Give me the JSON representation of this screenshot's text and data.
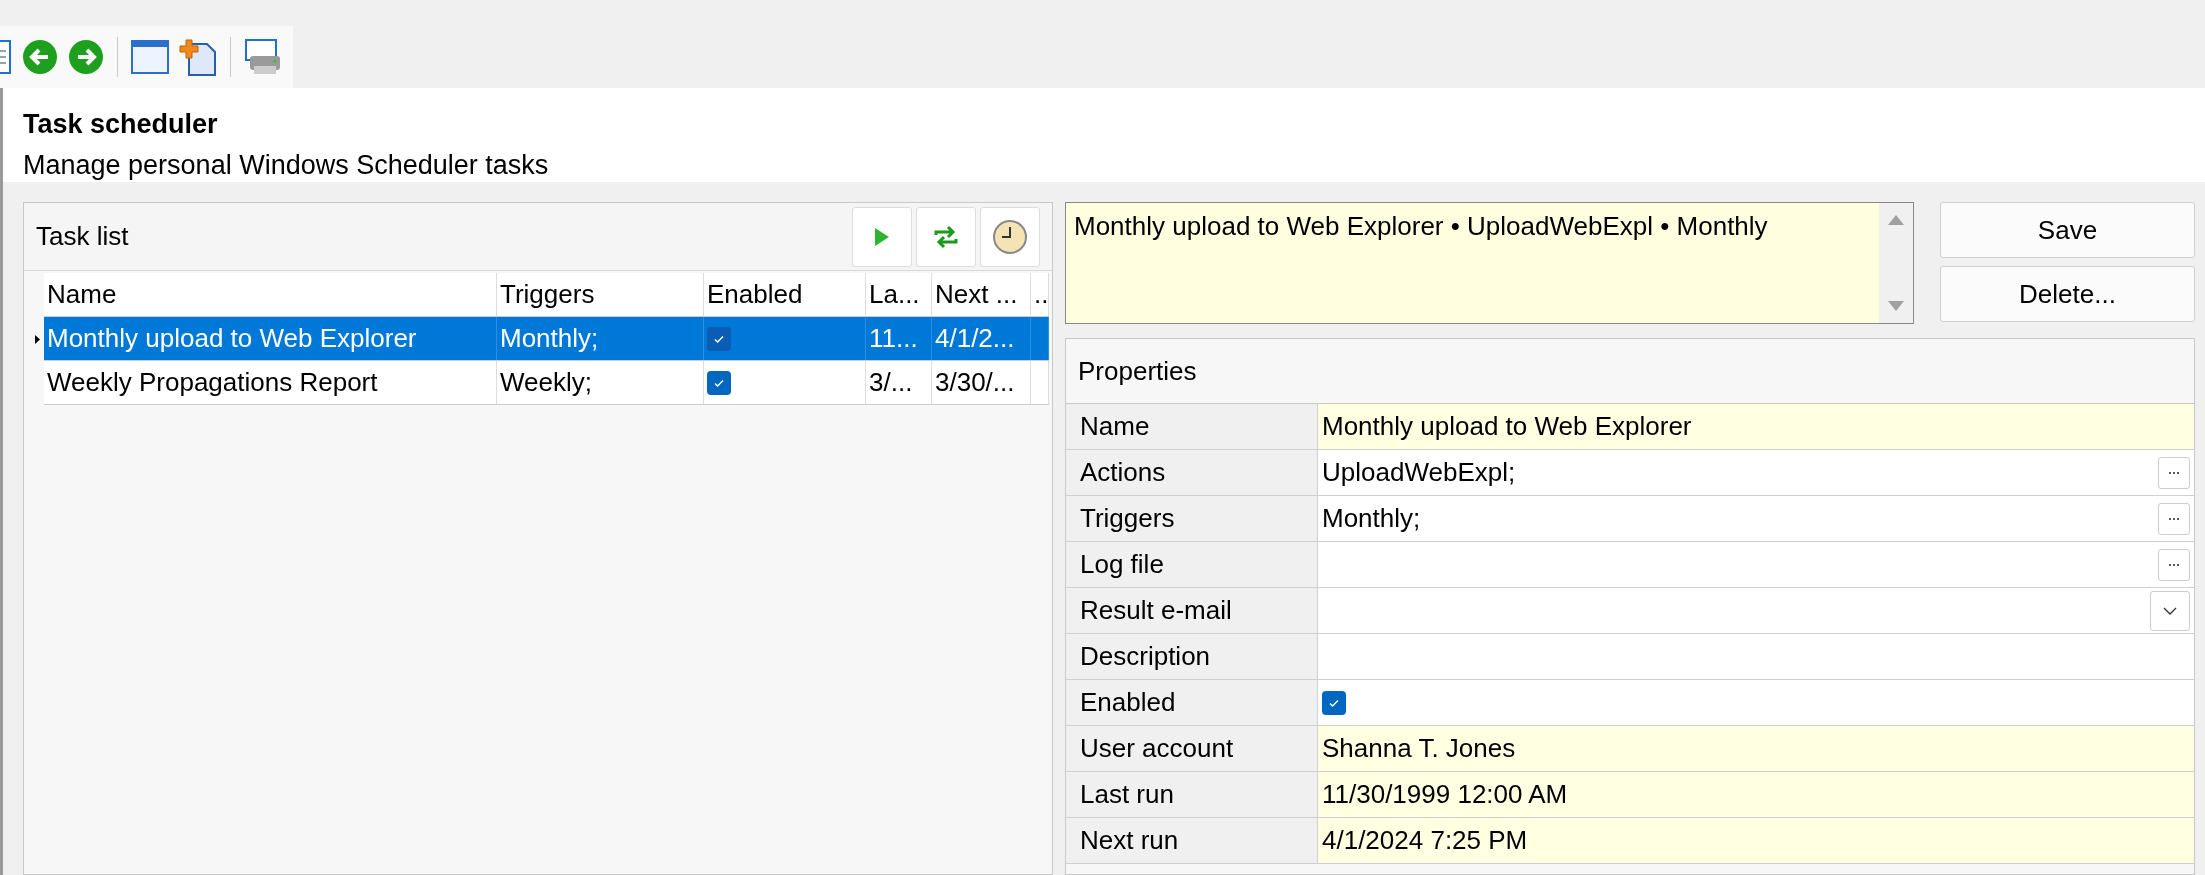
{
  "header": {
    "title": "Task scheduler",
    "subtitle": "Manage personal Windows Scheduler tasks"
  },
  "task_list": {
    "title": "Task list",
    "columns": [
      "Name",
      "Triggers",
      "Enabled",
      "La...",
      "Next ...",
      ".."
    ],
    "rows": [
      {
        "name": "Monthly upload to Web Explorer",
        "triggers": "Monthly;",
        "enabled": true,
        "column_4": "11...",
        "column_5": "4/1/2...",
        "selected": true
      },
      {
        "name": "Weekly Propagations Report",
        "triggers": "Weekly;",
        "enabled": true,
        "column_4": "3/...",
        "column_5": "3/30/...",
        "selected": false
      }
    ]
  },
  "summary": "Monthly upload to Web Explorer • UploadWebExpl • Monthly",
  "buttons": [
    "Save",
    "Delete..."
  ],
  "properties": {
    "title": "Properties",
    "rows": [
      {
        "label": "Name",
        "kind": "text",
        "value": "Monthly upload to Web Explorer",
        "readonly": true
      },
      {
        "label": "Actions",
        "kind": "browse",
        "value": "UploadWebExpl;",
        "readonly": false
      },
      {
        "label": "Triggers",
        "kind": "browse",
        "value": "Monthly;",
        "readonly": false
      },
      {
        "label": "Log file",
        "kind": "browse",
        "readonly": false
      },
      {
        "label": "Result e-mail",
        "kind": "dropdown",
        "readonly": false
      },
      {
        "label": "Description",
        "kind": "text",
        "readonly": false
      },
      {
        "label": "Enabled",
        "kind": "checkbox",
        "checked": true,
        "readonly": false
      },
      {
        "label": "User account",
        "kind": "text",
        "value": "Shanna T. Jones",
        "readonly": true
      },
      {
        "label": "Last run",
        "kind": "text",
        "value": "11/30/1999 12:00 AM",
        "readonly": true
      },
      {
        "label": "Next run",
        "kind": "text",
        "value": "4/1/2024 7:25 PM",
        "readonly": true
      }
    ]
  }
}
